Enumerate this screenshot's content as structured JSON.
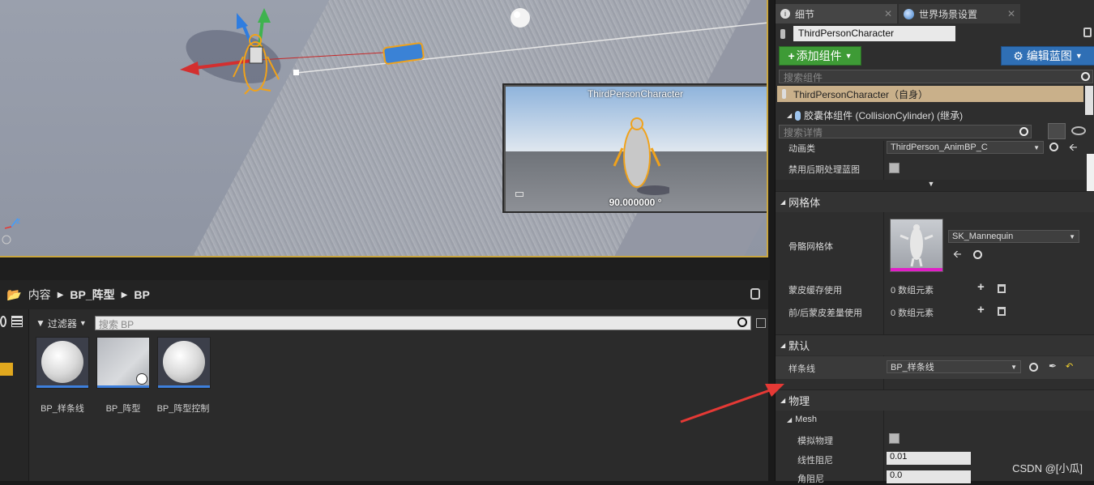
{
  "viewport": {
    "preview_title": "ThirdPersonCharacter",
    "preview_angle": "90.000000 °"
  },
  "content_browser": {
    "breadcrumb": [
      "内容",
      "BP_阵型",
      "BP"
    ],
    "filter_label": "过滤器",
    "search_placeholder": "搜索 BP",
    "assets": [
      "BP_样条线",
      "BP_阵型",
      "BP_阵型控制"
    ]
  },
  "details": {
    "tabs": [
      "细节",
      "世界场景设置"
    ],
    "actor_name": "ThirdPersonCharacter",
    "add_component_label": "添加组件",
    "edit_blueprint_label": "编辑蓝图",
    "search_components_placeholder": "搜索组件",
    "self_row": "ThirdPersonCharacter（自身）",
    "capsule_row": "胶囊体组件 (CollisionCylinder) (继承)",
    "search_details_placeholder": "搜索详情",
    "anim_class_label": "动画类",
    "anim_class_value": "ThirdPerson_AnimBP_C",
    "disable_post_label": "禁用后期处理蓝图",
    "mesh_section": "网格体",
    "skeletal_mesh_label": "骨骼网格体",
    "skeletal_mesh_value": "SK_Mannequin",
    "skin_cache_label": "蒙皮缓存使用",
    "skin_cache_value": "0 数组元素",
    "morph_label": "前/后蒙皮差量使用",
    "morph_value": "0 数组元素",
    "default_section": "默认",
    "spline_label": "样条线",
    "spline_value": "BP_样条线",
    "physics_section": "物理",
    "mesh_sub": "Mesh",
    "simulate_label": "模拟物理",
    "linear_damping_label": "线性阻尼",
    "linear_damping_value": "0.01",
    "angular_damping_label": "角阻尼",
    "angular_damping_value": "0.0"
  },
  "watermark": "CSDN @[小瓜]",
  "colors": {
    "accent_green": "#3e9b36",
    "accent_blue": "#2f6fb5",
    "self_row": "#c9b08a",
    "viewport_border": "#c9a640",
    "arrow": "#e53935"
  }
}
